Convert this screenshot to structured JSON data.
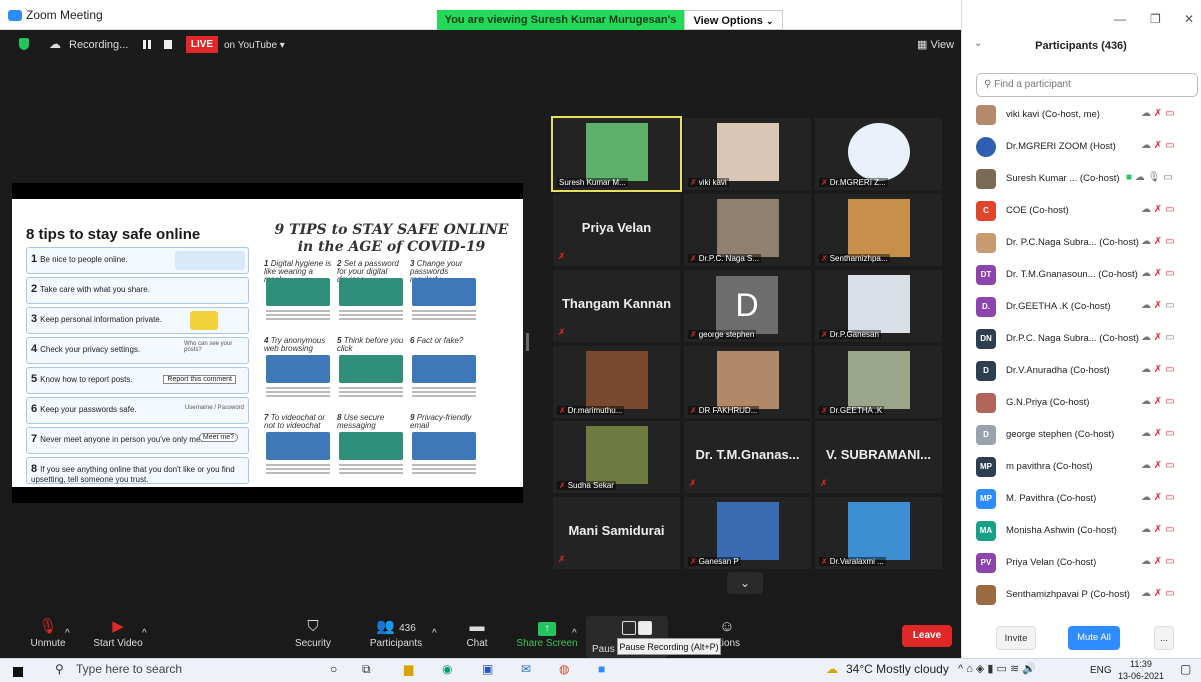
{
  "window": {
    "title": "Zoom Meeting"
  },
  "banner": {
    "viewing_text": "You are viewing Suresh Kumar Murugesan's screen",
    "view_options_label": "View Options"
  },
  "meeting_bar": {
    "recording_label": "Recording...",
    "live_label": "LIVE",
    "live_destination": "on YouTube",
    "view_label": "View"
  },
  "slide": {
    "left_title": "8 tips to stay safe online",
    "tips": [
      {
        "num": "1",
        "text": "Be nice to people online."
      },
      {
        "num": "2",
        "text": "Take care with what you share."
      },
      {
        "num": "3",
        "text": "Keep personal information private."
      },
      {
        "num": "4",
        "text": "Check your privacy settings."
      },
      {
        "num": "5",
        "text": "Know how to report posts."
      },
      {
        "num": "6",
        "text": "Keep your passwords safe."
      },
      {
        "num": "7",
        "text": "Never meet anyone in person you've only met online."
      },
      {
        "num": "8",
        "text": "If you see anything online that you don't like or you find upsetting, tell someone you trust."
      }
    ],
    "tip_art": {
      "t4": "Who can see your posts?",
      "t5": "Report this comment",
      "t6": "Username / Password",
      "t7": "Meet me?"
    },
    "right_title_line1": "9 TIPS to STAY SAFE ONLINE",
    "right_title_line2": "in the AGE of COVID-19",
    "right_tips": [
      {
        "num": "1",
        "text": "Digital hygiene is like wearing a mask"
      },
      {
        "num": "2",
        "text": "Set a password for your digital devices"
      },
      {
        "num": "3",
        "text": "Change your passwords regularly"
      },
      {
        "num": "4",
        "text": "Try anonymous web browsing"
      },
      {
        "num": "5",
        "text": "Think before you click"
      },
      {
        "num": "6",
        "text": "Fact or fake?"
      },
      {
        "num": "7",
        "text": "To videochat or not to videochat"
      },
      {
        "num": "8",
        "text": "Use secure messaging"
      },
      {
        "num": "9",
        "text": "Privacy-friendly email"
      }
    ]
  },
  "gallery": [
    {
      "name": "Suresh Kumar M...",
      "kind": "video"
    },
    {
      "name": "viki kavi",
      "kind": "video"
    },
    {
      "name": "Dr.MGRERI Z...",
      "kind": "video"
    },
    {
      "name": "Priya Velan",
      "kind": "name"
    },
    {
      "name": "Dr.P.C. Naga S...",
      "kind": "video"
    },
    {
      "name": "Senthamizhpa...",
      "kind": "video"
    },
    {
      "name": "Thangam Kannan",
      "kind": "name"
    },
    {
      "name": "george stephen",
      "kind": "letter",
      "letter": "D"
    },
    {
      "name": "Dr.P.Ganesan",
      "kind": "video"
    },
    {
      "name": "Dr.marimuthu...",
      "kind": "video"
    },
    {
      "name": "DR FAKHRUD...",
      "kind": "video"
    },
    {
      "name": "Dr.GEETHA .K",
      "kind": "video"
    },
    {
      "name": "Sudha Sekar",
      "kind": "video"
    },
    {
      "name": "Dr. T.M.Gnanas...",
      "kind": "name"
    },
    {
      "name": "V. SUBRAMANI...",
      "kind": "name"
    },
    {
      "name": "Mani Samidurai",
      "kind": "name"
    },
    {
      "name": "Ganesan P",
      "kind": "video"
    },
    {
      "name": "Dr.Varalaxmi ...",
      "kind": "video"
    }
  ],
  "controls": {
    "unmute": "Unmute",
    "start_video": "Start Video",
    "security": "Security",
    "participants": "Participants",
    "participants_count": "436",
    "chat": "Chat",
    "share_screen": "Share Screen",
    "pause_partial": "Paus",
    "reactions_partial": "ctions",
    "pause_tooltip": "Pause Recording (Alt+P)",
    "leave": "Leave"
  },
  "panel": {
    "title": "Participants (436)",
    "search_placeholder": "Find a participant",
    "invite": "Invite",
    "mute_all": "Mute All",
    "more": "...",
    "participants": [
      {
        "name": "viki kavi (Co-host, me)",
        "initials": "",
        "color": "#b58a6a"
      },
      {
        "name": "Dr.MGRERI ZOOM (Host)",
        "initials": "",
        "color": "#2f5fb3"
      },
      {
        "name": "Suresh Kumar ... (Co-host)",
        "initials": "",
        "color": "#7a6a55"
      },
      {
        "name": "COE (Co-host)",
        "initials": "C",
        "color": "#e0452c"
      },
      {
        "name": "Dr. P.C.Naga Subra... (Co-host)",
        "initials": "",
        "color": "#c89a70"
      },
      {
        "name": "Dr. T.M.Gnanasoun... (Co-host)",
        "initials": "DT",
        "color": "#8e44ad"
      },
      {
        "name": "Dr.GEETHA .K (Co-host)",
        "initials": "D.",
        "color": "#8e44ad"
      },
      {
        "name": "Dr.P.C. Naga Subra... (Co-host)",
        "initials": "DN",
        "color": "#2c3e50"
      },
      {
        "name": "Dr.V.Anuradha (Co-host)",
        "initials": "D",
        "color": "#2c3e50"
      },
      {
        "name": "G.N.Priya (Co-host)",
        "initials": "",
        "color": "#b0645a"
      },
      {
        "name": "george stephen (Co-host)",
        "initials": "D",
        "color": "#9aa3ad"
      },
      {
        "name": "m pavithra (Co-host)",
        "initials": "MP",
        "color": "#2c3e50"
      },
      {
        "name": "M. Pavithra (Co-host)",
        "initials": "MP",
        "color": "#2d8cff"
      },
      {
        "name": "Monisha Ashwin (Co-host)",
        "initials": "MA",
        "color": "#16a085"
      },
      {
        "name": "Priya Velan (Co-host)",
        "initials": "PV",
        "color": "#8e44ad"
      },
      {
        "name": "Senthamizhpavai P (Co-host)",
        "initials": "",
        "color": "#9a6a40"
      }
    ]
  },
  "taskbar": {
    "search_placeholder": "Type here to search",
    "weather": "34°C  Mostly cloudy",
    "lang": "ENG",
    "time": "11:39",
    "date": "13-06-2021"
  }
}
